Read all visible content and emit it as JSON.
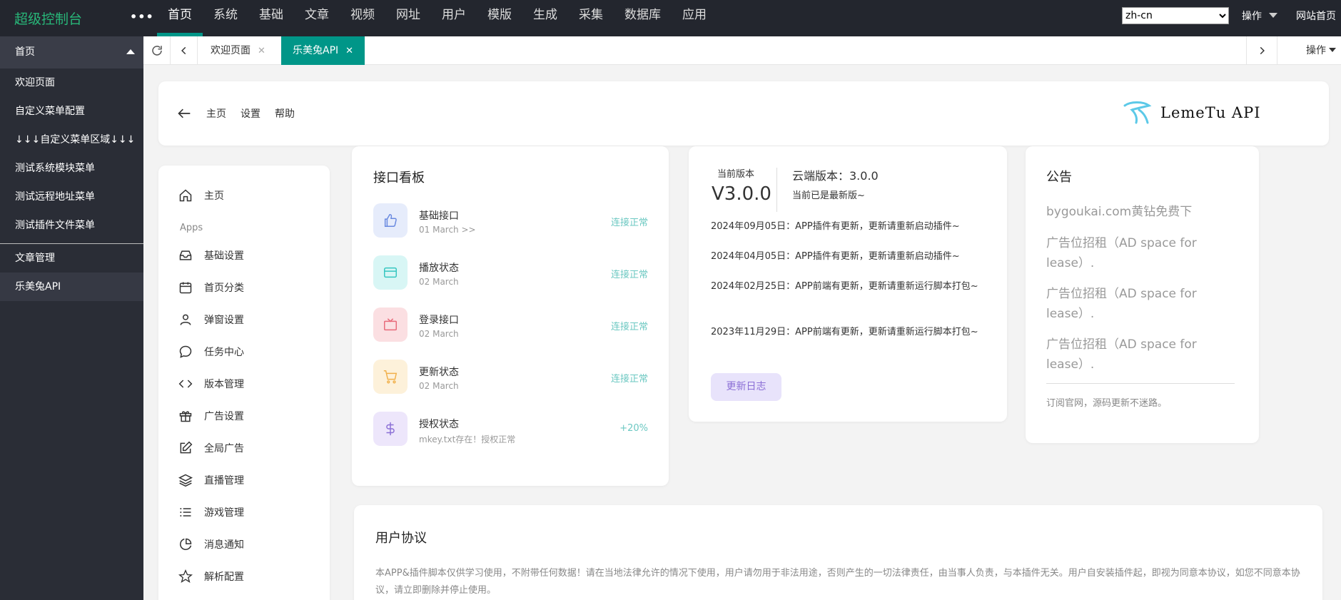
{
  "topbar": {
    "brand": "超级控制台",
    "more": "•••",
    "nav": [
      "首页",
      "系统",
      "基础",
      "文章",
      "视频",
      "网址",
      "用户",
      "模版",
      "生成",
      "采集",
      "数据库",
      "应用"
    ],
    "lang": "zh-cn",
    "operate": "操作",
    "site_home": "网站首页"
  },
  "sidebar": {
    "head": "首页",
    "items": [
      "欢迎页面",
      "自定义菜单配置",
      "↓↓↓自定义菜单区域↓↓↓",
      "测试系统模块菜单",
      "测试远程地址菜单",
      "测试插件文件菜单"
    ],
    "items2": [
      "文章管理",
      "乐美兔API"
    ]
  },
  "tabs": {
    "welcome": "欢迎页面",
    "current": "乐美兔API",
    "close": "✕",
    "operate": "操作"
  },
  "header": {
    "links": [
      "主页",
      "设置",
      "帮助"
    ],
    "logo_text": "LemeTu API"
  },
  "menu": {
    "home": "主页",
    "apps_label": "Apps",
    "items": [
      "基础设置",
      "首页分类",
      "弹窗设置",
      "任务中心",
      "版本管理",
      "广告设置",
      "全局广告",
      "直播管理",
      "游戏管理",
      "消息通知",
      "解析配置"
    ]
  },
  "api_board": {
    "title": "接口看板",
    "rows": [
      {
        "name": "基础接口",
        "sub": "01 March >>",
        "status": "连接正常",
        "icon": "thumbs-up-icon",
        "bg": "#e6ecfb",
        "fg": "#6a8ae0"
      },
      {
        "name": "播放状态",
        "sub": "02 March",
        "status": "连接正常",
        "icon": "credit-card-icon",
        "bg": "#d8f6f5",
        "fg": "#35c6c0"
      },
      {
        "name": "登录接口",
        "sub": "02 March",
        "status": "连接正常",
        "icon": "tv-icon",
        "bg": "#fbdfe2",
        "fg": "#e86a7a"
      },
      {
        "name": "更新状态",
        "sub": "02 March",
        "status": "连接正常",
        "icon": "cart-icon",
        "bg": "#fdf1da",
        "fg": "#f1b04a"
      },
      {
        "name": "授权状态",
        "sub": "mkey.txt存在！授权正常",
        "status": "+20%",
        "icon": "dollar-icon",
        "bg": "#ede6fb",
        "fg": "#8b6fd6"
      }
    ]
  },
  "version": {
    "label": "当前版本",
    "value": "V3.0.0",
    "cloud": "云端版本：3.0.0",
    "cloud_note": "当前已是最新版~",
    "logs": [
      "2024年09月05日：APP插件有更新，更新请重新启动插件~",
      "2024年04月05日：APP插件有更新，更新请重新启动插件~",
      "2024年02月25日：APP前端有更新，更新请重新运行脚本打包~",
      "2023年11月29日：APP前端有更新，更新请重新运行脚本打包~"
    ],
    "button": "更新日志"
  },
  "notice": {
    "title": "公告",
    "lines": [
      "bygoukai.com黄钻免费下",
      "广告位招租（AD space for lease）.",
      "广告位招租（AD space for lease）.",
      "广告位招租（AD space for lease）."
    ],
    "footer": "订阅官网，源码更新不迷路。"
  },
  "agreement": {
    "title": "用户协议",
    "text": "本APP&插件脚本仅供学习使用，不附带任何数据！请在当地法律允许的情况下使用，用户请勿用于非法用途，否则产生的一切法律责任，由当事人负责，与本插件无关。用户自安装插件起，即视为同意本协议，如您不同意本协议，请立即删除并停止使用。"
  }
}
